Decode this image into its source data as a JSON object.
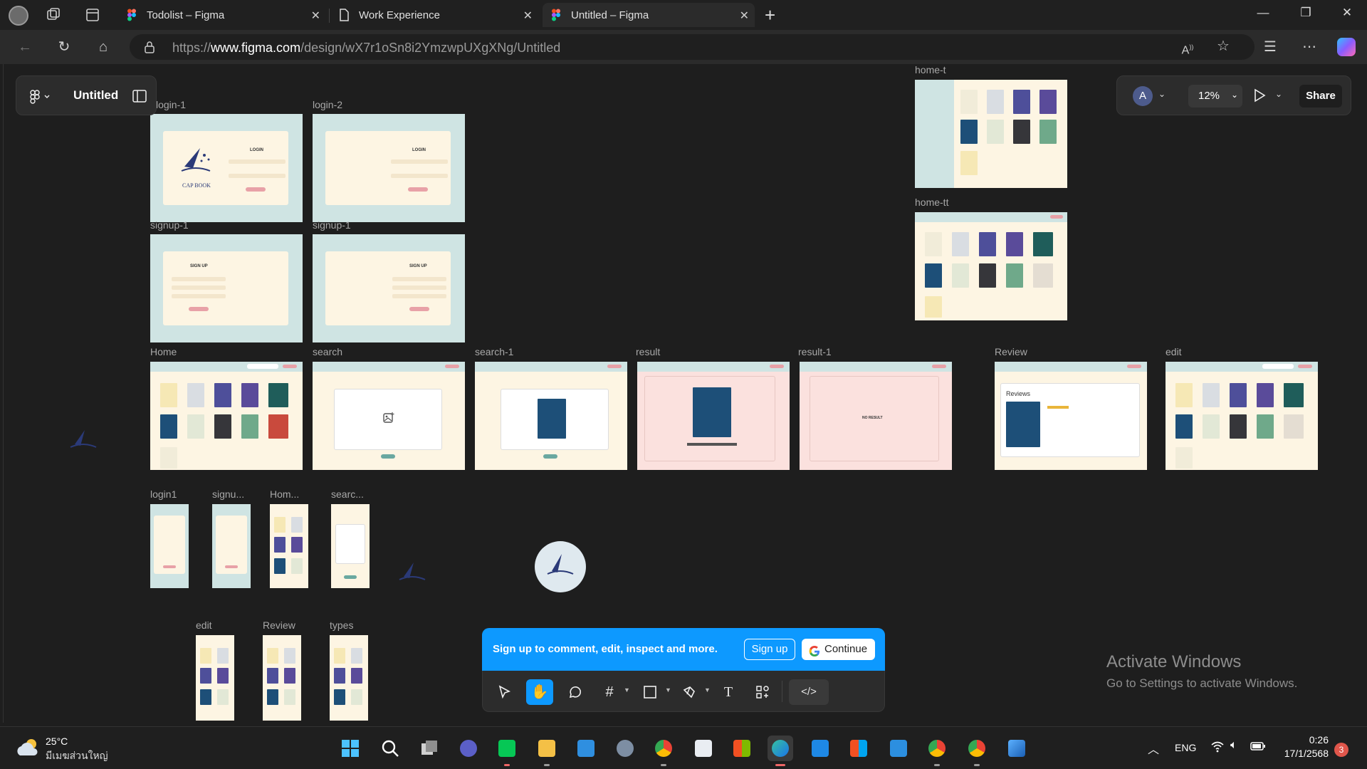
{
  "browser": {
    "tabs": [
      {
        "title": "Todolist – Figma",
        "icon": "figma-icon"
      },
      {
        "title": "Work Experience",
        "icon": "document-icon"
      },
      {
        "title": "Untitled – Figma",
        "icon": "figma-icon",
        "active": true
      }
    ],
    "url_prefix": "https://",
    "url_host": "www.figma.com",
    "url_path": "/design/wX7r1oSn8i2YmzwpUXgXNg/Untitled"
  },
  "figma": {
    "file_title": "Untitled",
    "avatar_initial": "A",
    "zoom": "12%",
    "share_label": "Share",
    "frames": {
      "login1": "login-1",
      "login2": "login-2",
      "signup1": "signup-1",
      "signup2": "signup-1",
      "home_t": "home-t",
      "home_tt": "home-tt",
      "home": "Home",
      "search": "search",
      "search1": "search-1",
      "result": "result",
      "result1": "result-1",
      "review": "Review",
      "edit": "edit",
      "m_login1": "login1",
      "m_signup": "signu...",
      "m_home": "Hom...",
      "m_search": "searc...",
      "m_edit": "edit",
      "m_review": "Review",
      "m_types": "types"
    },
    "frame_text": {
      "login": "LOGIN",
      "signup": "SIGN UP",
      "no_result": "NO RESULT",
      "reviews": "Reviews",
      "logo": "CAP BOOK"
    },
    "banner": {
      "message": "Sign up to comment, edit, inspect and more.",
      "signup_label": "Sign up",
      "continue_label": "Continue"
    },
    "tools": [
      "move-tool",
      "hand-tool",
      "comment-tool",
      "frame-tool",
      "shape-tool",
      "pen-tool",
      "text-tool",
      "components-tool",
      "dev-mode-tool"
    ]
  },
  "watermark": {
    "line1": "Activate Windows",
    "line2": "Go to Settings to activate Windows."
  },
  "taskbar": {
    "temperature": "25°C",
    "location": "มีเมฆส่วนใหญ่",
    "language": "ENG",
    "time": "0:26",
    "date": "17/1/2568",
    "notification_count": "3"
  },
  "colors": {
    "figma_blue": "#0d99ff",
    "frame_teal": "#cfe4e3",
    "frame_cream": "#fdf5e3",
    "frame_pink": "#e8a1a7"
  }
}
